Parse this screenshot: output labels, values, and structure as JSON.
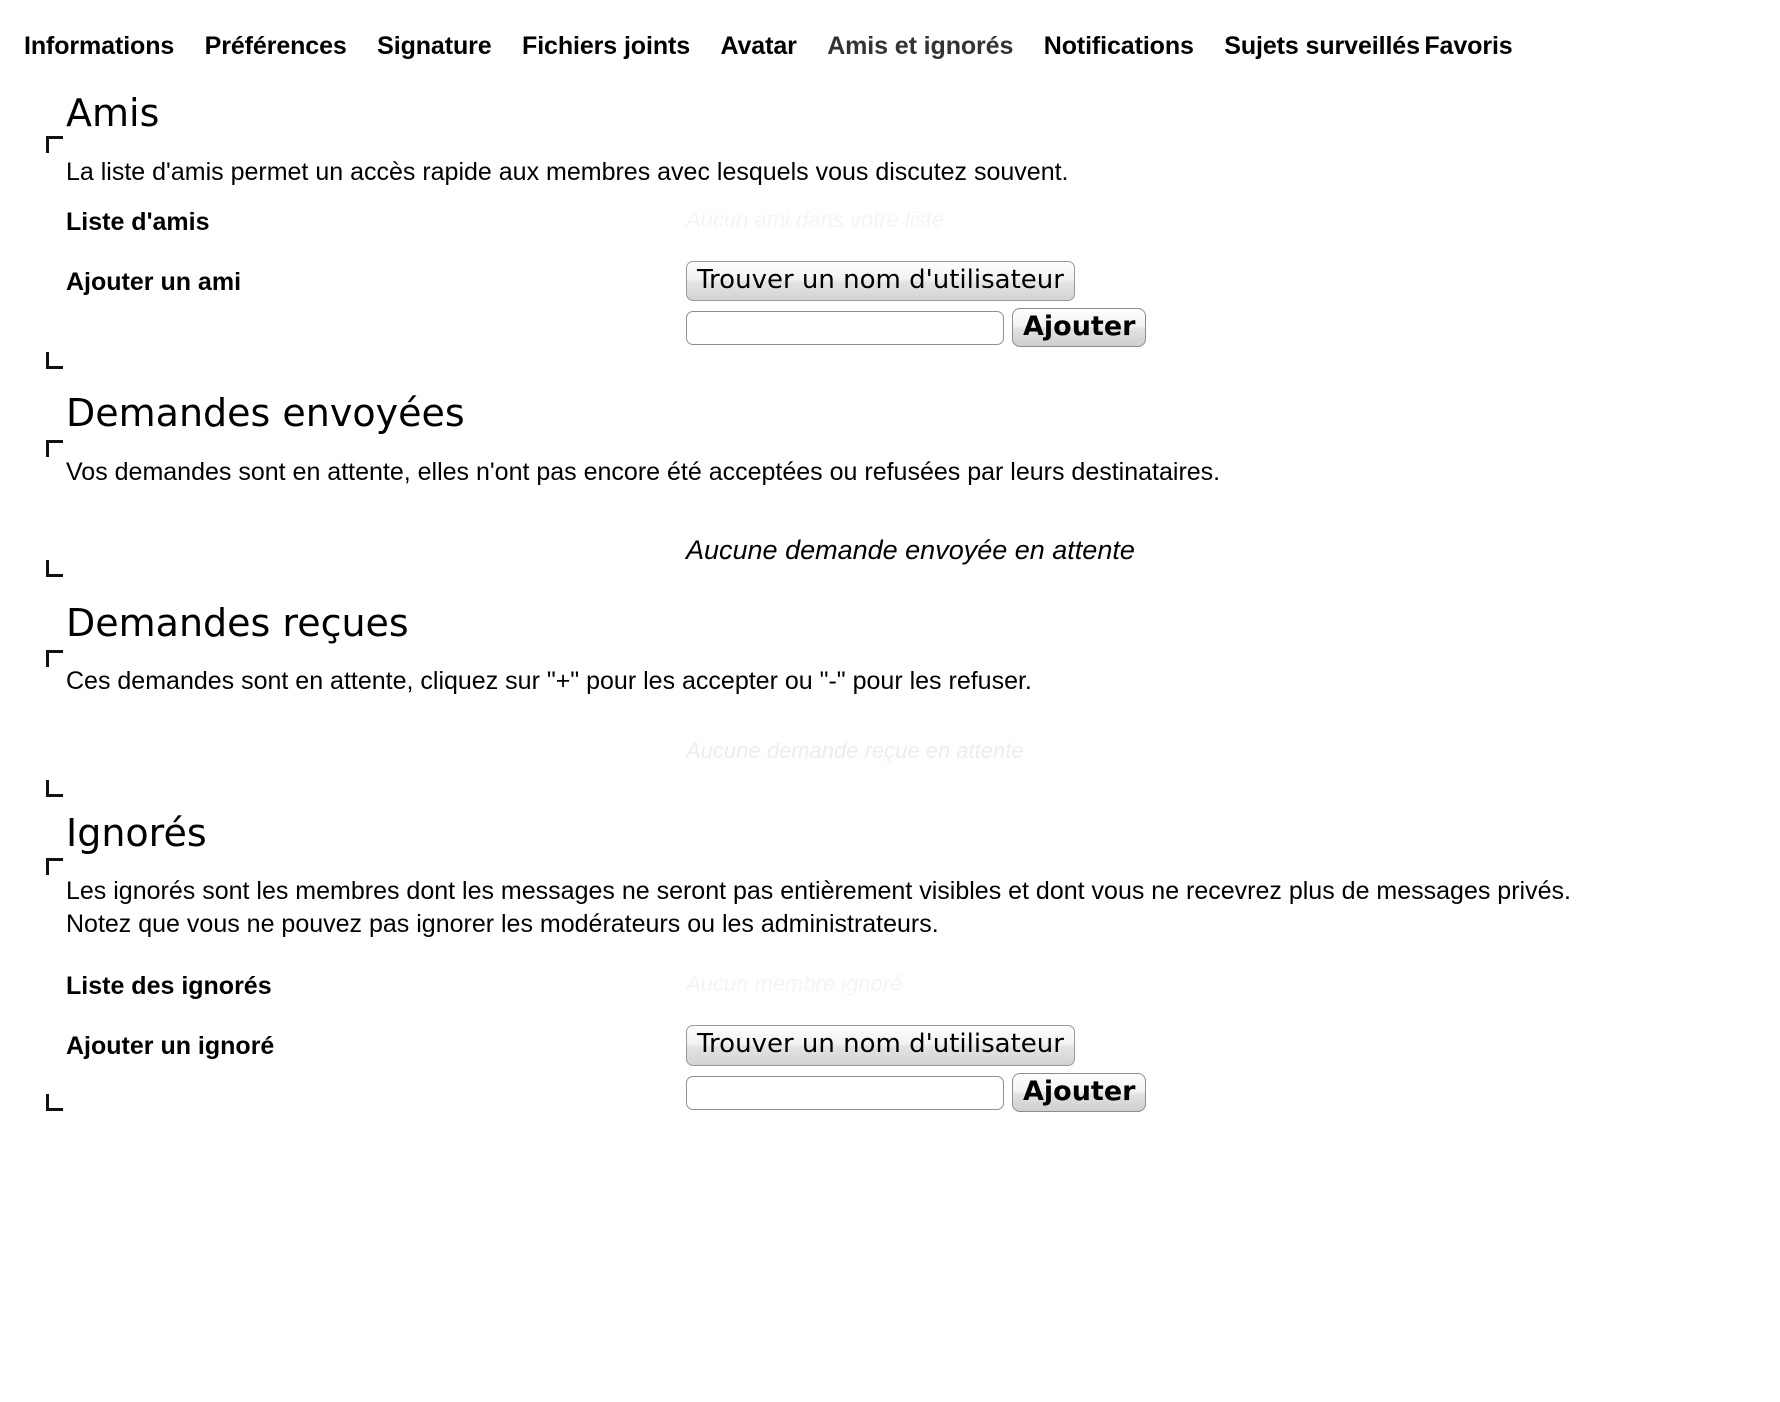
{
  "nav": {
    "items": [
      {
        "label": "Informations",
        "active": false
      },
      {
        "label": "Préférences",
        "active": false
      },
      {
        "label": "Signature",
        "active": false
      },
      {
        "label": "Fichiers joints",
        "active": false
      },
      {
        "label": "Avatar",
        "active": false
      },
      {
        "label": "Amis et ignorés",
        "active": true
      },
      {
        "label": "Notifications",
        "active": false
      },
      {
        "label": "Sujets surveillés",
        "active": false
      },
      {
        "label": "Favoris",
        "active": false
      }
    ]
  },
  "sections": {
    "friends": {
      "title": "Amis",
      "description": "La liste d'amis permet un accès rapide aux membres avec lesquels vous discutez souvent.",
      "list_label": "Liste d'amis",
      "list_value": "Aucun ami dans votre liste",
      "add_label": "Ajouter un ami",
      "finder_label": "Trouver un nom d'utilisateur",
      "input_value": "",
      "input_placeholder": "",
      "submit_label": "Ajouter"
    },
    "sent_requests": {
      "title": "Demandes envoyées",
      "description": "Vos demandes sont en attente, elles n'ont pas encore été acceptées ou refusées par leurs destinataires.",
      "empty_note": "Aucune demande envoyée en attente"
    },
    "received_requests": {
      "title": "Demandes reçues",
      "description": "Ces demandes sont en attente, cliquez sur \"+\" pour les accepter ou \"-\" pour les refuser.",
      "empty_note": "Aucune demande reçue en attente"
    },
    "ignored": {
      "title": "Ignorés",
      "description_line1": "Les ignorés sont les membres dont les messages ne seront pas entièrement visibles et dont vous ne recevrez plus de messages privés.",
      "description_line2": "Notez que vous ne pouvez pas ignorer les modérateurs ou les administrateurs.",
      "list_label": "Liste des ignorés",
      "list_value": "Aucun membre ignoré",
      "add_label": "Ajouter un ignoré",
      "finder_label": "Trouver un nom d'utilisateur",
      "input_value": "",
      "input_placeholder": "",
      "submit_label": "Ajouter"
    }
  },
  "colors": {
    "active_nav": "#333333",
    "text": "#000000",
    "background": "#ffffff",
    "received_faint": "#008000"
  }
}
